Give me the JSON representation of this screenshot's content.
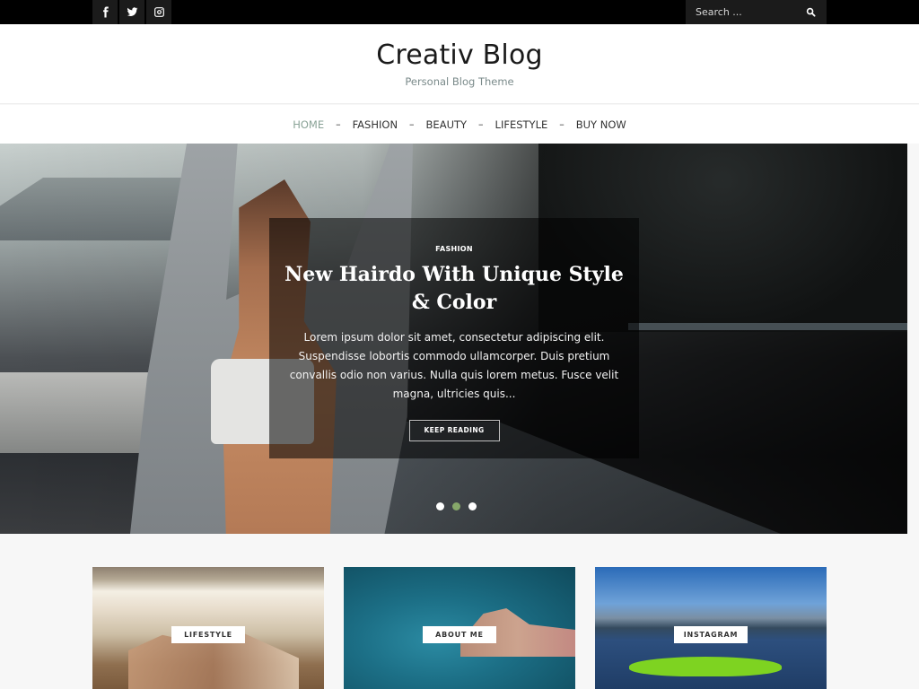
{
  "topbar": {
    "social": [
      {
        "icon": "facebook-icon",
        "label": "Facebook"
      },
      {
        "icon": "twitter-icon",
        "label": "Twitter"
      },
      {
        "icon": "instagram-icon",
        "label": "Instagram"
      }
    ],
    "search": {
      "placeholder": "Search ...",
      "value": "",
      "icon": "search-icon"
    }
  },
  "header": {
    "title": "Creativ Blog",
    "tagline": "Personal Blog Theme"
  },
  "nav": {
    "separator": "–",
    "items": [
      {
        "label": "HOME",
        "active": true
      },
      {
        "label": "FASHION",
        "active": false
      },
      {
        "label": "BEAUTY",
        "active": false
      },
      {
        "label": "LIFESTYLE",
        "active": false
      },
      {
        "label": "BUY NOW",
        "active": false
      }
    ]
  },
  "slider": {
    "category": "FASHION",
    "title": "New Hairdo With Unique Style & Color",
    "excerpt": "Lorem ipsum dolor sit amet, consectetur adipiscing elit. Suspendisse lobortis commodo ullamcorper. Duis pretium convallis odio non varius. Nulla quis lorem metus. Fusce velit magna, ultricies quis...",
    "button_label": "KEEP READING",
    "dots": {
      "count": 3,
      "active_index": 1
    },
    "active_dot_color": "#86a86a"
  },
  "promos": [
    {
      "label": "LIFESTYLE"
    },
    {
      "label": "ABOUT ME"
    },
    {
      "label": "INSTAGRAM"
    }
  ],
  "colors": {
    "accent": "#8aa397",
    "topbar_bg": "#000000",
    "button_bg": "#1b1b1b"
  }
}
